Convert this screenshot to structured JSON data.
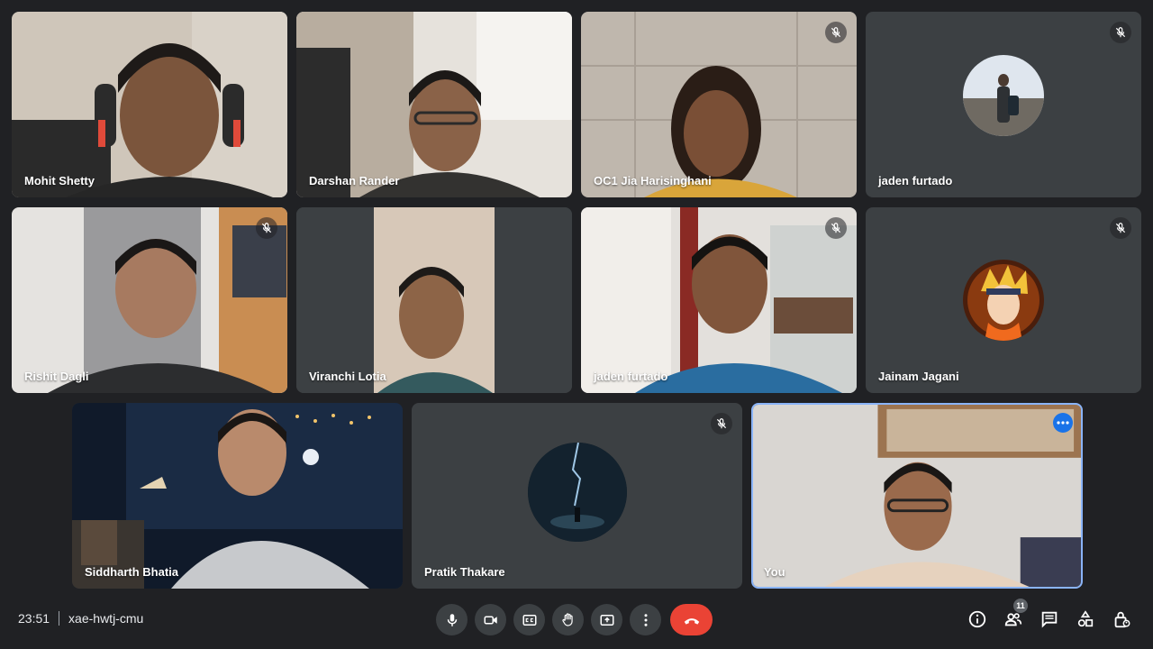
{
  "participants": [
    {
      "name": "Mohit Shetty",
      "muted": false
    },
    {
      "name": "Darshan Rander",
      "muted": false
    },
    {
      "name": "OC1 Jia Harisinghani",
      "muted": true
    },
    {
      "name": "jaden furtado",
      "muted": true
    },
    {
      "name": "Rishit Dagli",
      "muted": true
    },
    {
      "name": "Viranchi Lotia",
      "muted": false
    },
    {
      "name": "jaden furtado",
      "muted": true
    },
    {
      "name": "Jainam Jagani",
      "muted": true
    },
    {
      "name": "Siddharth Bhatia",
      "muted": false
    },
    {
      "name": "Pratik Thakare",
      "muted": true
    },
    {
      "name": "You",
      "muted": false
    }
  ],
  "meeting": {
    "time": "23:51",
    "code": "xae-hwtj-cmu"
  },
  "people_count": "11",
  "colors": {
    "background": "#202124",
    "tile": "#3c4043",
    "end_call": "#ea4335",
    "self_border": "#8ab4f8",
    "accent": "#1a73e8"
  }
}
